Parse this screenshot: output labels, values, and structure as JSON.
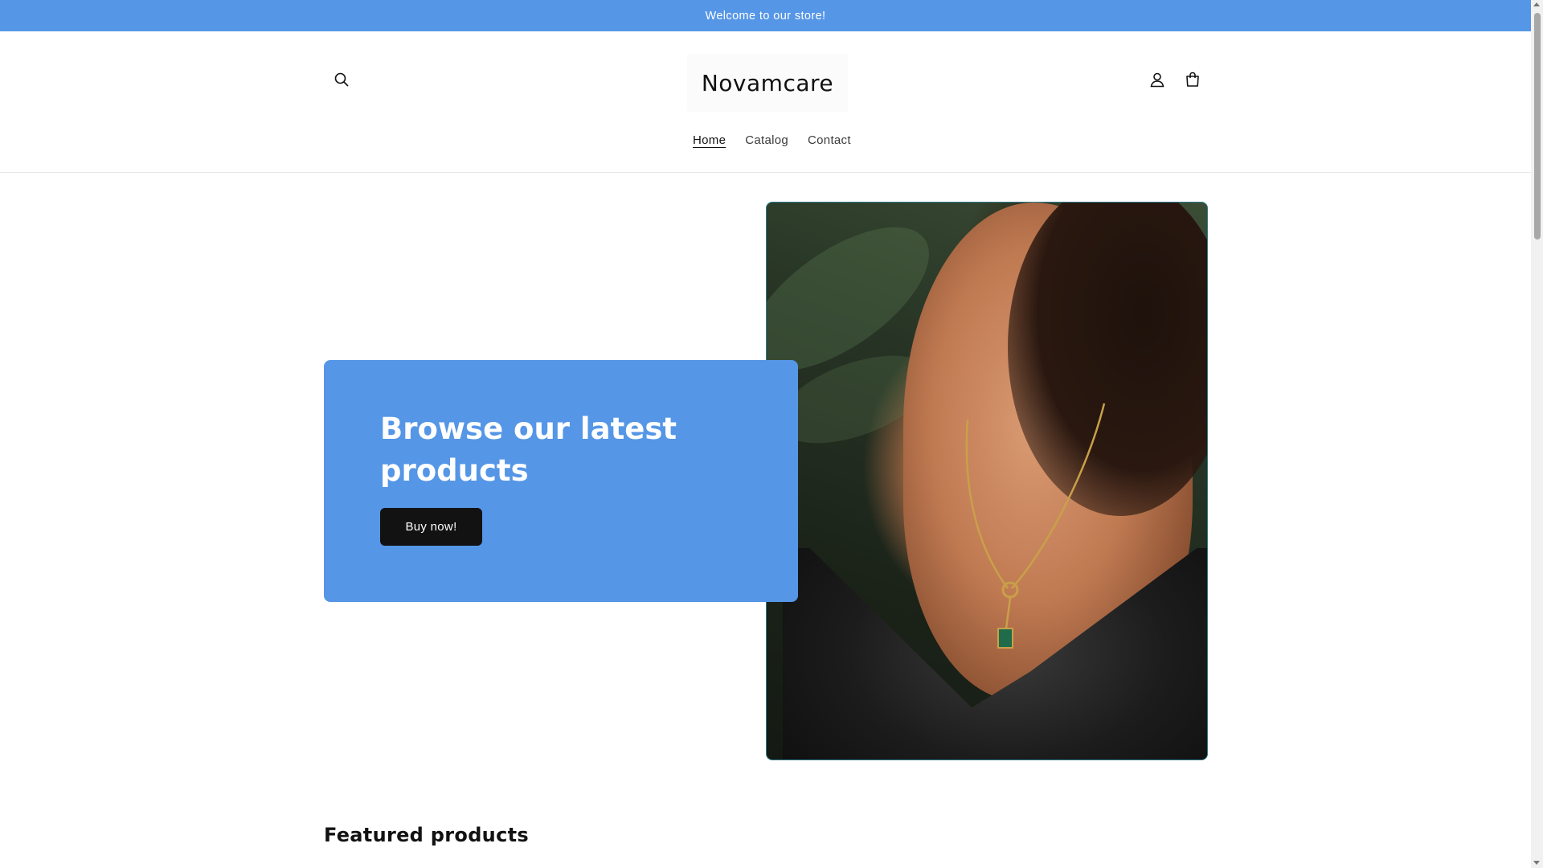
{
  "announcement": {
    "text": "Welcome to our store!",
    "background_color": "#5596e6"
  },
  "header": {
    "logo_text": "Novamcare",
    "icons": {
      "search": "search-icon",
      "account": "user-icon",
      "cart": "cart-icon"
    },
    "nav": [
      {
        "label": "Home",
        "active": true
      },
      {
        "label": "Catalog",
        "active": false
      },
      {
        "label": "Contact",
        "active": false
      }
    ]
  },
  "hero": {
    "title": "Browse our latest products",
    "button_label": "Buy now!",
    "card_color": "#5596e6",
    "button_color": "#121212"
  },
  "featured": {
    "title": "Featured products"
  }
}
